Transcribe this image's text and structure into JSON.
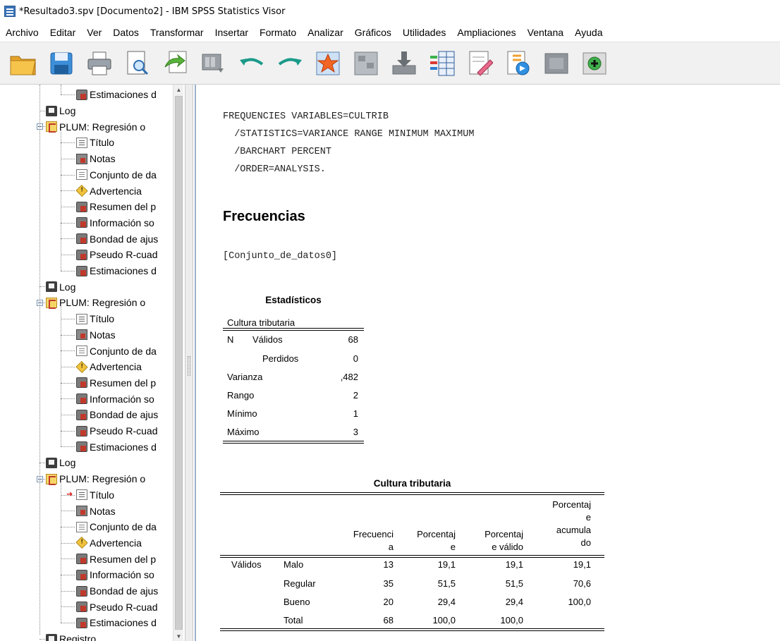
{
  "window": {
    "title": "*Resultado3.spv [Documento2] - IBM SPSS Statistics Visor"
  },
  "menu": [
    "Archivo",
    "Editar",
    "Ver",
    "Datos",
    "Transformar",
    "Insertar",
    "Formato",
    "Analizar",
    "Gráficos",
    "Utilidades",
    "Ampliaciones",
    "Ventana",
    "Ayuda"
  ],
  "toolbar": {
    "icons": [
      "open-folder-icon",
      "save-icon",
      "print-icon",
      "print-preview-icon",
      "export-icon",
      "recall-dialog-icon",
      "undo-icon",
      "redo-icon",
      "goto-data-icon",
      "goto-case-icon",
      "goto-variable-icon",
      "variables-icon",
      "create-title-icon",
      "insert-output-icon",
      "disabled-slot-icon",
      "add-item-icon"
    ]
  },
  "outline": [
    {
      "label": "Estimaciones d",
      "icon": "table-icon",
      "level": 2
    },
    {
      "label": "Log",
      "icon": "log-icon",
      "level": 1
    },
    {
      "label": "PLUM: Regresión o",
      "icon": "plum-icon",
      "level": 1,
      "expanded": true
    },
    {
      "label": "Título",
      "icon": "title-icon",
      "level": 2
    },
    {
      "label": "Notas",
      "icon": "notes-icon",
      "level": 2
    },
    {
      "label": "Conjunto de da",
      "icon": "doc-icon",
      "level": 2
    },
    {
      "label": "Advertencia",
      "icon": "warning-icon",
      "level": 2
    },
    {
      "label": "Resumen del p",
      "icon": "table-icon",
      "level": 2
    },
    {
      "label": "Información so",
      "icon": "table-icon",
      "level": 2
    },
    {
      "label": "Bondad de ajus",
      "icon": "table-icon",
      "level": 2
    },
    {
      "label": "Pseudo R-cuad",
      "icon": "table-icon",
      "level": 2
    },
    {
      "label": "Estimaciones d",
      "icon": "table-icon",
      "level": 2
    },
    {
      "label": "Log",
      "icon": "log-icon",
      "level": 1
    },
    {
      "label": "PLUM: Regresión o",
      "icon": "plum-icon",
      "level": 1,
      "expanded": true
    },
    {
      "label": "Título",
      "icon": "title-icon",
      "level": 2
    },
    {
      "label": "Notas",
      "icon": "notes-icon",
      "level": 2
    },
    {
      "label": "Conjunto de da",
      "icon": "doc-icon",
      "level": 2
    },
    {
      "label": "Advertencia",
      "icon": "warning-icon",
      "level": 2
    },
    {
      "label": "Resumen del p",
      "icon": "table-icon",
      "level": 2
    },
    {
      "label": "Información so",
      "icon": "table-icon",
      "level": 2
    },
    {
      "label": "Bondad de ajus",
      "icon": "table-icon",
      "level": 2
    },
    {
      "label": "Pseudo R-cuad",
      "icon": "table-icon",
      "level": 2
    },
    {
      "label": "Estimaciones d",
      "icon": "table-icon",
      "level": 2
    },
    {
      "label": "Log",
      "icon": "log-icon",
      "level": 1
    },
    {
      "label": "PLUM: Regresión o",
      "icon": "plum-icon",
      "level": 1,
      "expanded": true
    },
    {
      "label": "Título",
      "icon": "title-icon",
      "level": 2,
      "current": true
    },
    {
      "label": "Notas",
      "icon": "notes-icon",
      "level": 2
    },
    {
      "label": "Conjunto de da",
      "icon": "doc-icon",
      "level": 2
    },
    {
      "label": "Advertencia",
      "icon": "warning-icon",
      "level": 2
    },
    {
      "label": "Resumen del p",
      "icon": "table-icon",
      "level": 2
    },
    {
      "label": "Información so",
      "icon": "table-icon",
      "level": 2
    },
    {
      "label": "Bondad de ajus",
      "icon": "table-icon",
      "level": 2
    },
    {
      "label": "Pseudo R-cuad",
      "icon": "table-icon",
      "level": 2
    },
    {
      "label": "Estimaciones d",
      "icon": "table-icon",
      "level": 2
    },
    {
      "label": "Registro",
      "icon": "log-icon",
      "level": 1
    }
  ],
  "syntax": [
    "FREQUENCIES VARIABLES=CULTRIB",
    "  /STATISTICS=VARIANCE RANGE MINIMUM MAXIMUM",
    "  /BARCHART PERCENT",
    "  /ORDER=ANALYSIS."
  ],
  "heading": "Frecuencias",
  "dataset": "[Conjunto_de_datos0]",
  "stats_table": {
    "caption": "Estadísticos",
    "variable": "Cultura tributaria",
    "rows": [
      {
        "col1": "N",
        "col2": "Válidos",
        "value": "68"
      },
      {
        "col1": "",
        "col2": "Perdidos",
        "value": "0"
      },
      {
        "col1": "Varianza",
        "col2": "",
        "value": ",482"
      },
      {
        "col1": "Rango",
        "col2": "",
        "value": "2"
      },
      {
        "col1": "Mínimo",
        "col2": "",
        "value": "1"
      },
      {
        "col1": "Máximo",
        "col2": "",
        "value": "3"
      }
    ]
  },
  "freq_table": {
    "caption": "Cultura tributaria",
    "headers": [
      "Frecuenci\na",
      "Porcentaj\ne",
      "Porcentaj\ne válido",
      "Porcentaj\ne\nacumula\ndo"
    ],
    "group": "Válidos",
    "rows": [
      {
        "label": "Malo",
        "freq": "13",
        "pct": "19,1",
        "valid": "19,1",
        "cum": "19,1"
      },
      {
        "label": "Regular",
        "freq": "35",
        "pct": "51,5",
        "valid": "51,5",
        "cum": "70,6"
      },
      {
        "label": "Bueno",
        "freq": "20",
        "pct": "29,4",
        "valid": "29,4",
        "cum": "100,0"
      },
      {
        "label": "Total",
        "freq": "68",
        "pct": "100,0",
        "valid": "100,0",
        "cum": ""
      }
    ]
  }
}
